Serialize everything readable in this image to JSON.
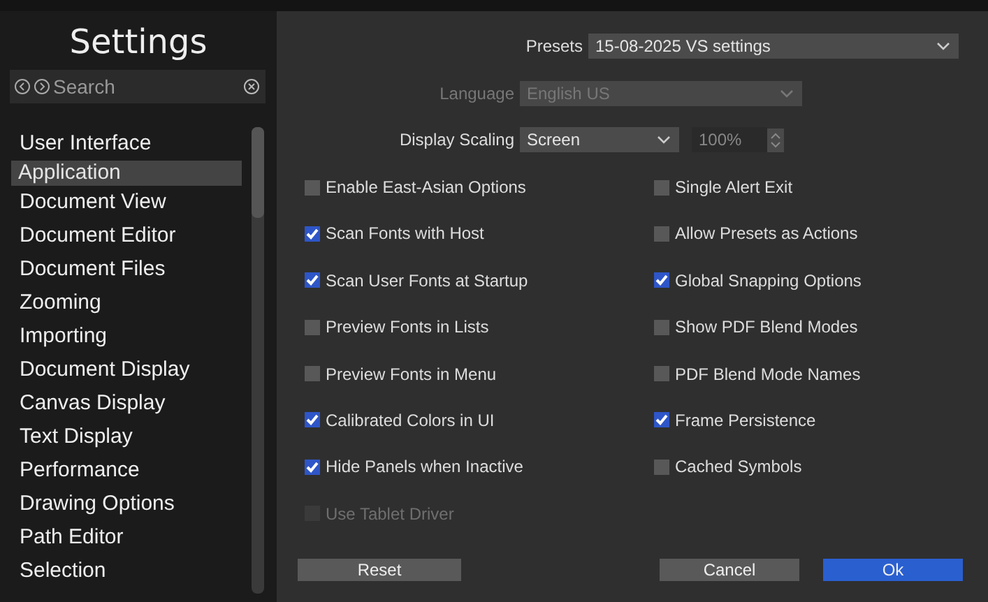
{
  "sidebar": {
    "title": "Settings",
    "search": {
      "placeholder": "Search"
    },
    "items": [
      {
        "label": "User Interface",
        "selected": false
      },
      {
        "label": "Application",
        "selected": true
      },
      {
        "label": "Document View",
        "selected": false
      },
      {
        "label": "Document Editor",
        "selected": false
      },
      {
        "label": "Document Files",
        "selected": false
      },
      {
        "label": "Zooming",
        "selected": false
      },
      {
        "label": "Importing",
        "selected": false
      },
      {
        "label": "Document Display",
        "selected": false
      },
      {
        "label": "Canvas Display",
        "selected": false
      },
      {
        "label": "Text Display",
        "selected": false
      },
      {
        "label": "Performance",
        "selected": false
      },
      {
        "label": "Drawing Options",
        "selected": false
      },
      {
        "label": "Path Editor",
        "selected": false
      },
      {
        "label": "Selection",
        "selected": false
      }
    ]
  },
  "presets": {
    "label": "Presets",
    "value": "15-08-2025 VS settings"
  },
  "language": {
    "label": "Language",
    "value": "English US",
    "disabled": true
  },
  "display_scaling": {
    "label": "Display Scaling",
    "value": "Screen",
    "percent": "100%"
  },
  "options": [
    {
      "label": "Enable East-Asian Options",
      "checked": false,
      "disabled": false
    },
    {
      "label": "Scan Fonts with Host",
      "checked": true,
      "disabled": false
    },
    {
      "label": "Scan User Fonts at Startup",
      "checked": true,
      "disabled": false
    },
    {
      "label": "Preview Fonts in Lists",
      "checked": false,
      "disabled": false
    },
    {
      "label": "Preview Fonts in Menu",
      "checked": false,
      "disabled": false
    },
    {
      "label": "Calibrated Colors in UI",
      "checked": true,
      "disabled": false
    },
    {
      "label": "Hide Panels when Inactive",
      "checked": true,
      "disabled": false
    },
    {
      "label": "Use Tablet Driver",
      "checked": false,
      "disabled": true
    },
    {
      "label": "Single Alert Exit",
      "checked": false,
      "disabled": false
    },
    {
      "label": "Allow Presets as Actions",
      "checked": false,
      "disabled": false
    },
    {
      "label": "Global Snapping Options",
      "checked": true,
      "disabled": false
    },
    {
      "label": "Show PDF Blend Modes",
      "checked": false,
      "disabled": false
    },
    {
      "label": "PDF Blend Mode Names",
      "checked": false,
      "disabled": false
    },
    {
      "label": "Frame Persistence",
      "checked": true,
      "disabled": false
    },
    {
      "label": "Cached Symbols",
      "checked": false,
      "disabled": false
    }
  ],
  "buttons": [
    {
      "label": "Reset",
      "kind": "plain"
    },
    {
      "label": "Cancel",
      "kind": "plain"
    },
    {
      "label": "Ok",
      "kind": "primary"
    }
  ]
}
